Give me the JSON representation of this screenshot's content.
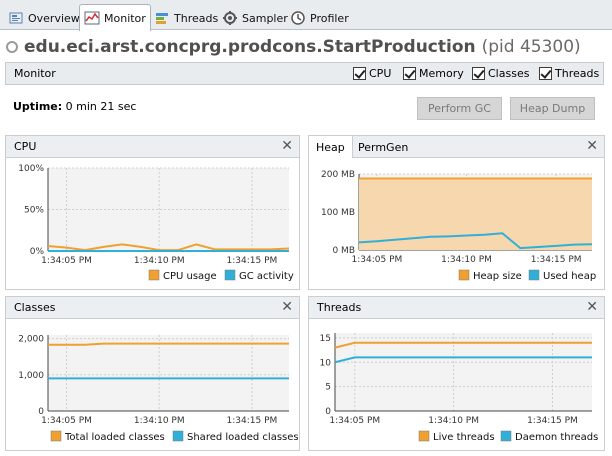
{
  "tabs": [
    {
      "label": "Overview",
      "icon": "overview-icon"
    },
    {
      "label": "Monitor",
      "icon": "monitor-icon"
    },
    {
      "label": "Threads",
      "icon": "threads-icon"
    },
    {
      "label": "Sampler",
      "icon": "sampler-icon"
    },
    {
      "label": "Profiler",
      "icon": "profiler-icon"
    }
  ],
  "active_tab": "Monitor",
  "title": {
    "app": "edu.eci.arst.concprg.prodcons.StartProduction",
    "pid": "(pid 45300)"
  },
  "monitor_bar": {
    "label": "Monitor",
    "checkboxes": [
      {
        "label": "CPU",
        "checked": true
      },
      {
        "label": "Memory",
        "checked": true
      },
      {
        "label": "Classes",
        "checked": true
      },
      {
        "label": "Threads",
        "checked": true
      }
    ]
  },
  "uptime": {
    "label": "Uptime:",
    "value": "0 min 21 sec"
  },
  "buttons": {
    "perform_gc": "Perform GC",
    "heap_dump": "Heap Dump"
  },
  "panels": {
    "cpu": {
      "title": "CPU"
    },
    "heap": {
      "tab_heap": "Heap",
      "tab_permgen": "PermGen"
    },
    "classes": {
      "title": "Classes"
    },
    "threads": {
      "title": "Threads"
    }
  },
  "colors": {
    "orange": "#f0a030",
    "blue": "#30b0d8",
    "heap_fill": "#f7d7ad"
  },
  "chart_data": [
    {
      "id": "cpu",
      "type": "line",
      "x": [
        "1:34:04",
        "1:34:05",
        "1:34:06",
        "1:34:07",
        "1:34:08",
        "1:34:09",
        "1:34:10",
        "1:34:11",
        "1:34:12",
        "1:34:13",
        "1:34:14",
        "1:34:15",
        "1:34:16",
        "1:34:17"
      ],
      "x_ticks": [
        "1:34:05 PM",
        "1:34:10 PM",
        "1:34:15 PM"
      ],
      "y_ticks": [
        "100%",
        "50%",
        "0%"
      ],
      "ylim": [
        0,
        100
      ],
      "series": [
        {
          "name": "CPU usage",
          "color": "#f0a030",
          "values": [
            6,
            4,
            1,
            5,
            8,
            5,
            1,
            1,
            8,
            2,
            2,
            2,
            2,
            3
          ]
        },
        {
          "name": "GC activity",
          "color": "#30b0d8",
          "values": [
            0,
            0,
            0,
            0,
            0,
            0,
            0,
            0,
            0,
            0,
            0,
            0,
            0,
            0
          ]
        }
      ]
    },
    {
      "id": "heap",
      "type": "area",
      "x": [
        "1:34:04",
        "1:34:05",
        "1:34:06",
        "1:34:07",
        "1:34:08",
        "1:34:09",
        "1:34:10",
        "1:34:11",
        "1:34:12",
        "1:34:13",
        "1:34:14",
        "1:34:15",
        "1:34:16",
        "1:34:17"
      ],
      "x_ticks": [
        "1:34:05 PM",
        "1:34:10 PM",
        "1:34:15 PM"
      ],
      "y_ticks": [
        "200 MB",
        "100 MB",
        "0 MB"
      ],
      "ylim": [
        0,
        200
      ],
      "series": [
        {
          "name": "Heap size",
          "color": "#f0a030",
          "values": [
            188,
            188,
            188,
            188,
            188,
            188,
            188,
            188,
            188,
            188,
            188,
            188,
            188,
            188
          ]
        },
        {
          "name": "Used heap",
          "color": "#30b0d8",
          "values": [
            20,
            23,
            27,
            31,
            35,
            36,
            38,
            40,
            44,
            5,
            8,
            11,
            14,
            15
          ]
        }
      ]
    },
    {
      "id": "classes",
      "type": "line",
      "x": [
        "1:34:04",
        "1:34:05",
        "1:34:06",
        "1:34:07",
        "1:34:08",
        "1:34:09",
        "1:34:10",
        "1:34:11",
        "1:34:12",
        "1:34:13",
        "1:34:14",
        "1:34:15",
        "1:34:16",
        "1:34:17"
      ],
      "x_ticks": [
        "1:34:05 PM",
        "1:34:10 PM",
        "1:34:15 PM"
      ],
      "y_ticks": [
        "2,000",
        "1,000",
        "0"
      ],
      "ylim": [
        0,
        2100
      ],
      "series": [
        {
          "name": "Total loaded classes",
          "color": "#f0a030",
          "values": [
            1830,
            1830,
            1830,
            1860,
            1860,
            1860,
            1860,
            1860,
            1860,
            1860,
            1860,
            1860,
            1860,
            1860
          ]
        },
        {
          "name": "Shared loaded classes",
          "color": "#30b0d8",
          "values": [
            900,
            900,
            900,
            900,
            900,
            900,
            900,
            900,
            900,
            900,
            900,
            900,
            900,
            900
          ]
        }
      ]
    },
    {
      "id": "threads",
      "type": "line",
      "x": [
        "1:34:04",
        "1:34:05",
        "1:34:06",
        "1:34:07",
        "1:34:08",
        "1:34:09",
        "1:34:10",
        "1:34:11",
        "1:34:12",
        "1:34:13",
        "1:34:14",
        "1:34:15",
        "1:34:16",
        "1:34:17"
      ],
      "x_ticks": [
        "1:34:05 PM",
        "1:34:10 PM",
        "1:34:15 PM"
      ],
      "y_ticks": [
        "15",
        "10",
        "5",
        "0"
      ],
      "ylim": [
        0,
        16
      ],
      "series": [
        {
          "name": "Live threads",
          "color": "#f0a030",
          "values": [
            13,
            14,
            14,
            14,
            14,
            14,
            14,
            14,
            14,
            14,
            14,
            14,
            14,
            14
          ]
        },
        {
          "name": "Daemon threads",
          "color": "#30b0d8",
          "values": [
            10,
            11,
            11,
            11,
            11,
            11,
            11,
            11,
            11,
            11,
            11,
            11,
            11,
            11
          ]
        }
      ]
    }
  ]
}
